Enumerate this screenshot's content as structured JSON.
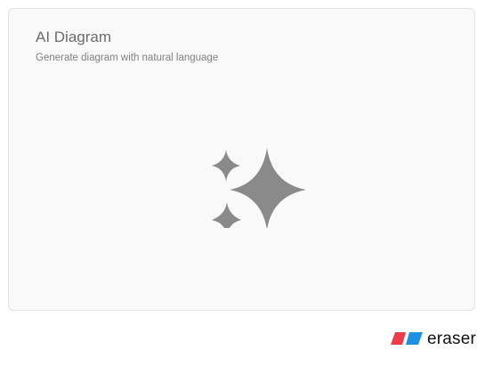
{
  "card": {
    "title": "AI Diagram",
    "subtitle": "Generate diagram with natural language",
    "icon": "sparkles-icon"
  },
  "brand": {
    "name": "eraser",
    "logo_icon": "eraser-logo-icon",
    "colors": {
      "red": "#ee3b4a",
      "blue": "#1f8fe0"
    }
  },
  "colors": {
    "icon": "#8a8a8a",
    "card_background": "#f9f9f9",
    "card_border": "#e2e2e2"
  }
}
